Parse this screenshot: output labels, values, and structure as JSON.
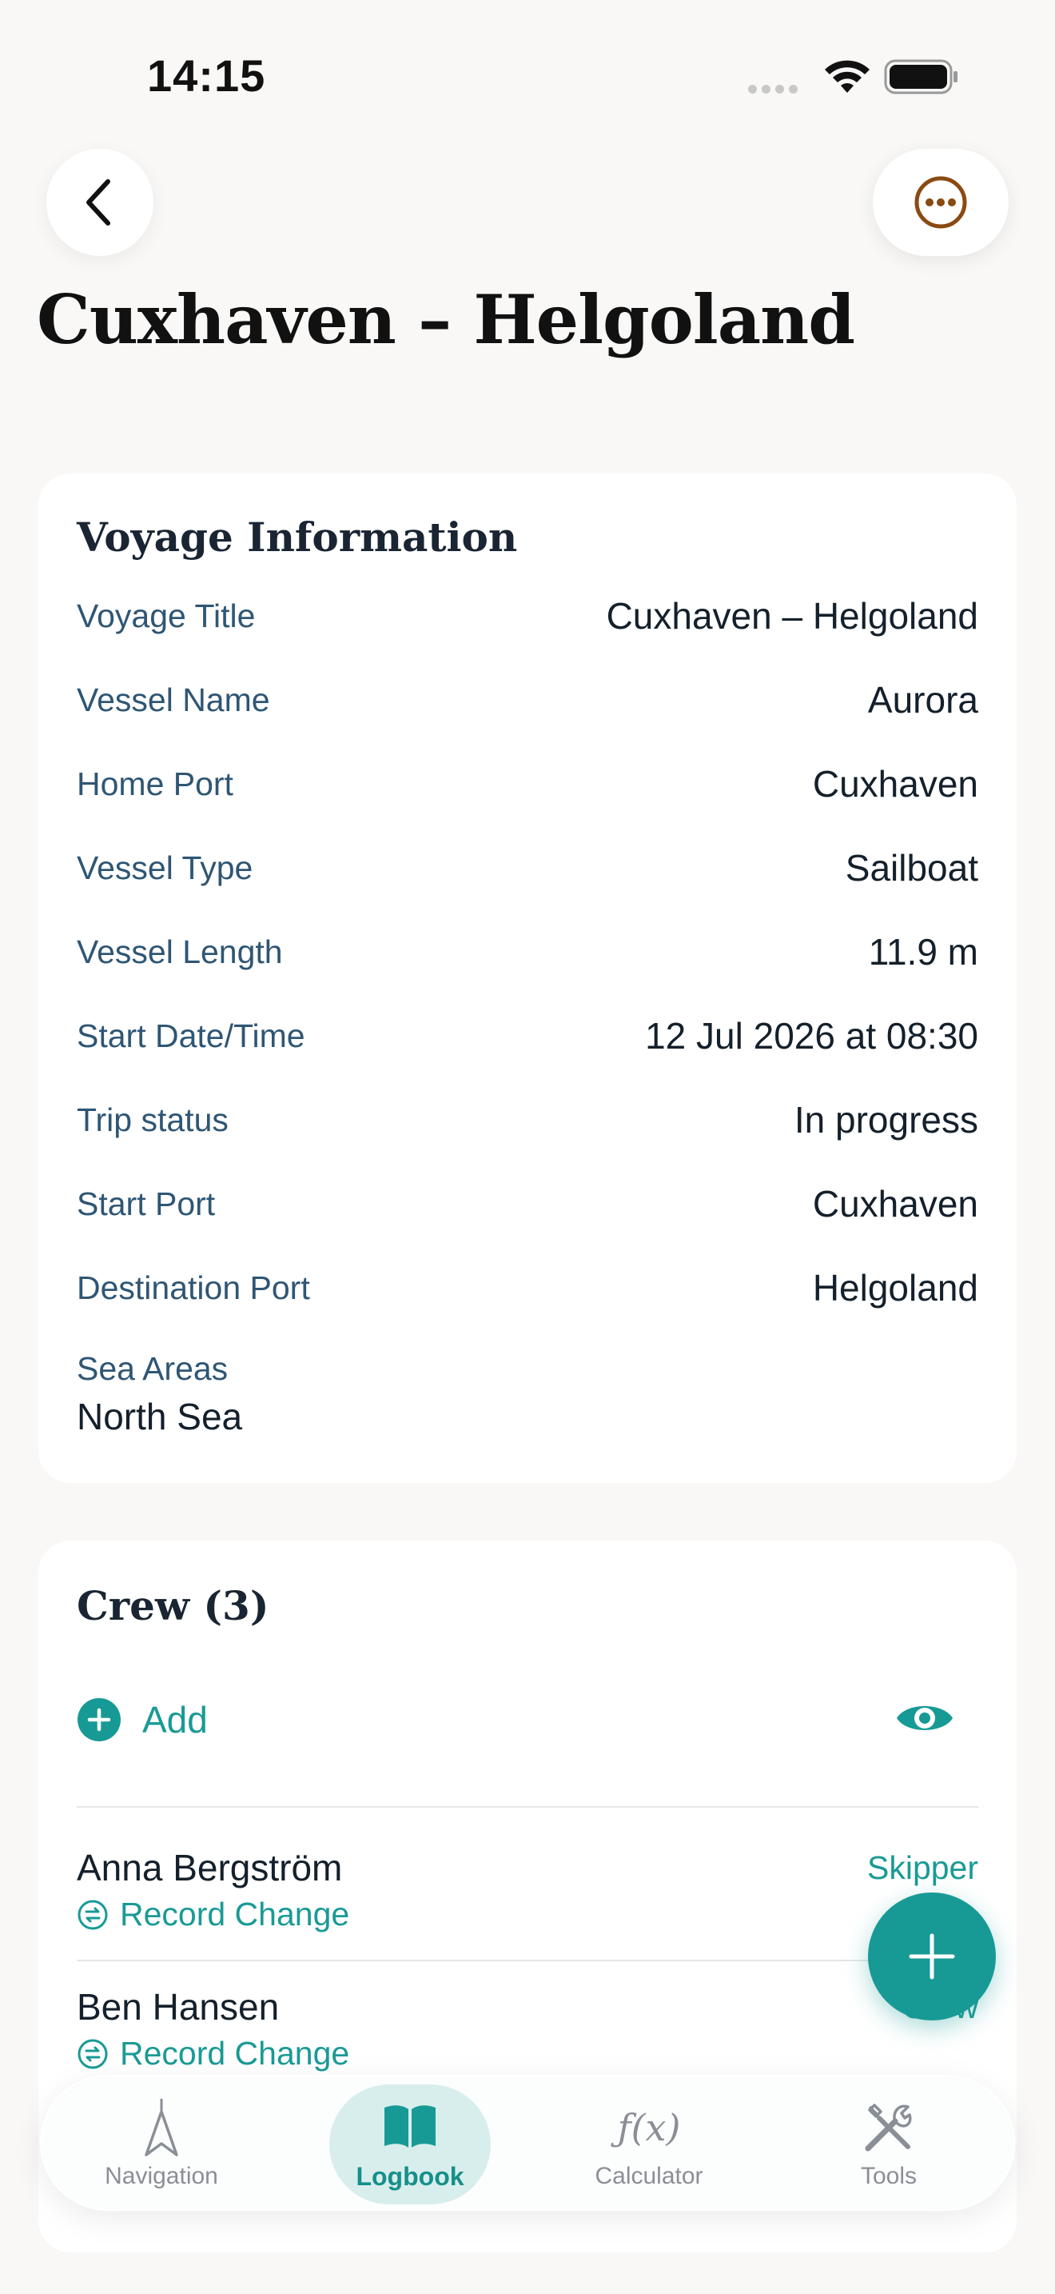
{
  "status_bar": {
    "time": "14:15"
  },
  "header": {
    "title": "Cuxhaven – Helgoland"
  },
  "voyage": {
    "title": "Voyage Information",
    "rows": [
      {
        "label": "Voyage Title",
        "value": "Cuxhaven – Helgoland"
      },
      {
        "label": "Vessel Name",
        "value": "Aurora"
      },
      {
        "label": "Home Port",
        "value": "Cuxhaven"
      },
      {
        "label": "Vessel Type",
        "value": "Sailboat"
      },
      {
        "label": "Vessel Length",
        "value": "11.9 m"
      },
      {
        "label": "Start Date/Time",
        "value": "12 Jul 2026 at 08:30"
      },
      {
        "label": "Trip status",
        "value": "In progress"
      },
      {
        "label": "Start Port",
        "value": "Cuxhaven"
      },
      {
        "label": "Destination Port",
        "value": "Helgoland"
      }
    ],
    "sea_areas": {
      "label": "Sea Areas",
      "value": "North Sea"
    }
  },
  "crew": {
    "title": "Crew (3)",
    "add_label": "Add",
    "members": [
      {
        "name": "Anna Bergström",
        "role": "Skipper",
        "action": "Record Change"
      },
      {
        "name": "Ben Hansen",
        "role": "Crew",
        "action": "Record Change"
      }
    ]
  },
  "tabs": [
    {
      "label": "Navigation"
    },
    {
      "label": "Logbook"
    },
    {
      "label": "Calculator"
    },
    {
      "label": "Tools"
    }
  ],
  "calculator_icon_text": "ƒ(x)",
  "colors": {
    "accent": "#179a96",
    "label": "#2f5674",
    "more_icon": "#8a4a12",
    "background": "#f9f8f6"
  }
}
